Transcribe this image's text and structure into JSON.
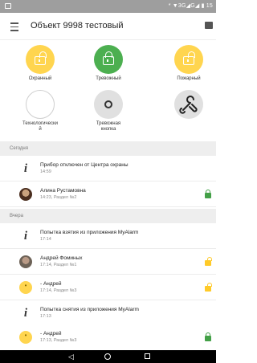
{
  "statusbar": {
    "indicators": "* ▼3G◢G◢ ▮ 15"
  },
  "appbar": {
    "title": "Объект 9998 тестовый"
  },
  "tiles": [
    {
      "label": "Охранный",
      "color": "#ffd54f",
      "icon": "lock-open-icon"
    },
    {
      "label": "Тревожный",
      "color": "#4caf50",
      "icon": "lock-closed-icon"
    },
    {
      "label": "Пожарный",
      "color": "#ffd54f",
      "icon": "lock-open-icon"
    },
    {
      "label": "Технологически\nй",
      "color": "#ffffff",
      "icon": "empty-circle-icon"
    },
    {
      "label": "Тревожная\nкнопка",
      "color": "#e0e0e0",
      "icon": "ring-icon"
    },
    {
      "label": "",
      "color": "#e0e0e0",
      "icon": "wrench-icon"
    }
  ],
  "sections": [
    {
      "header": "Сегодня",
      "events": [
        {
          "icon": "info-icon",
          "title": "Прибор отключен от Центра охраны",
          "sub": "14:59",
          "status": ""
        },
        {
          "icon": "avatar-photo",
          "title": "Алина Рустамовна",
          "sub": "14:23, Раздел №2",
          "status": "lock-green"
        }
      ]
    },
    {
      "header": "Вчера",
      "events": [
        {
          "icon": "info-icon",
          "title": "Попытка взятия из приложения MyAlarm",
          "sub": "17:14",
          "status": ""
        },
        {
          "icon": "avatar-photo",
          "title": "Андрей Фоминых",
          "sub": "17:14, Раздел №1",
          "status": "lock-yellow"
        },
        {
          "icon": "avatar-yellow",
          "title": "- Андрей",
          "sub": "17:14, Раздел №3",
          "status": "lock-yellow"
        },
        {
          "icon": "info-icon",
          "title": "Попытка снятия из приложения MyAlarm",
          "sub": "17:13",
          "status": ""
        },
        {
          "icon": "avatar-yellow",
          "title": "- Андрей",
          "sub": "17:13, Раздел №3",
          "status": "lock-green"
        }
      ]
    }
  ],
  "navbar": {
    "back": "◁",
    "home": "○",
    "recent": "□"
  }
}
